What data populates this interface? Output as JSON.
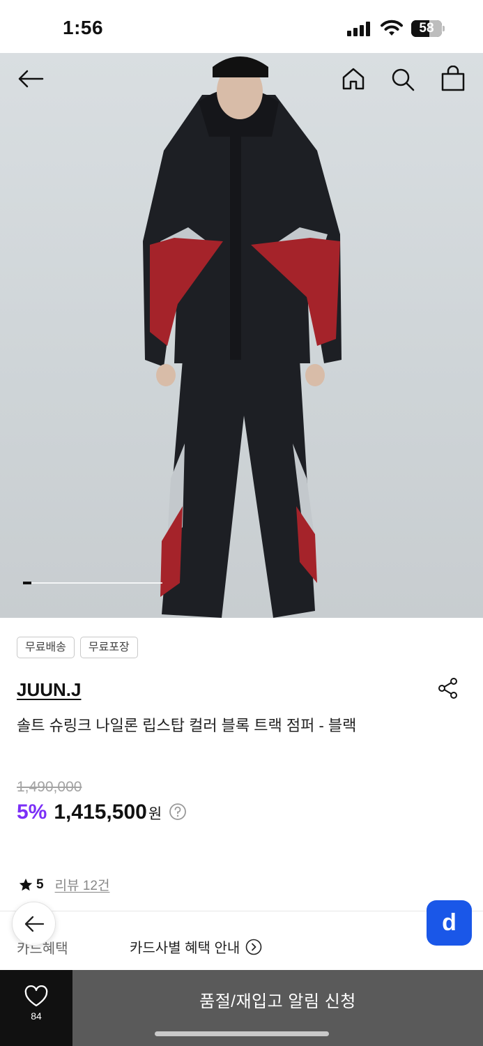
{
  "status_bar": {
    "time": "1:56",
    "battery": "58"
  },
  "hero": {
    "image_subject": "model wearing black, red and grey nylon track jumper and pants",
    "slide_position": "1"
  },
  "badges": [
    "무료배송",
    "무료포장"
  ],
  "product": {
    "brand": "JUUN.J",
    "title": "솔트 슈링크 나일론 립스탑 컬러 블록 트랙 점퍼 - 블랙",
    "original_price": "1,490,000",
    "discount": "5%",
    "price": "1,415,500",
    "currency": "원"
  },
  "rating": {
    "value": "5",
    "review_link": "리뷰 12건"
  },
  "benefits": {
    "label": "카드혜택",
    "link": "카드사별 혜택 안내"
  },
  "floating": {
    "d_button": "d"
  },
  "bottom_bar": {
    "like_count": "84",
    "cta_label": "품절/재입고 알림 신청"
  },
  "colors": {
    "discount": "#7b2ff7",
    "d_button": "#1a57e8",
    "cta_bg": "#5a5a5a"
  }
}
